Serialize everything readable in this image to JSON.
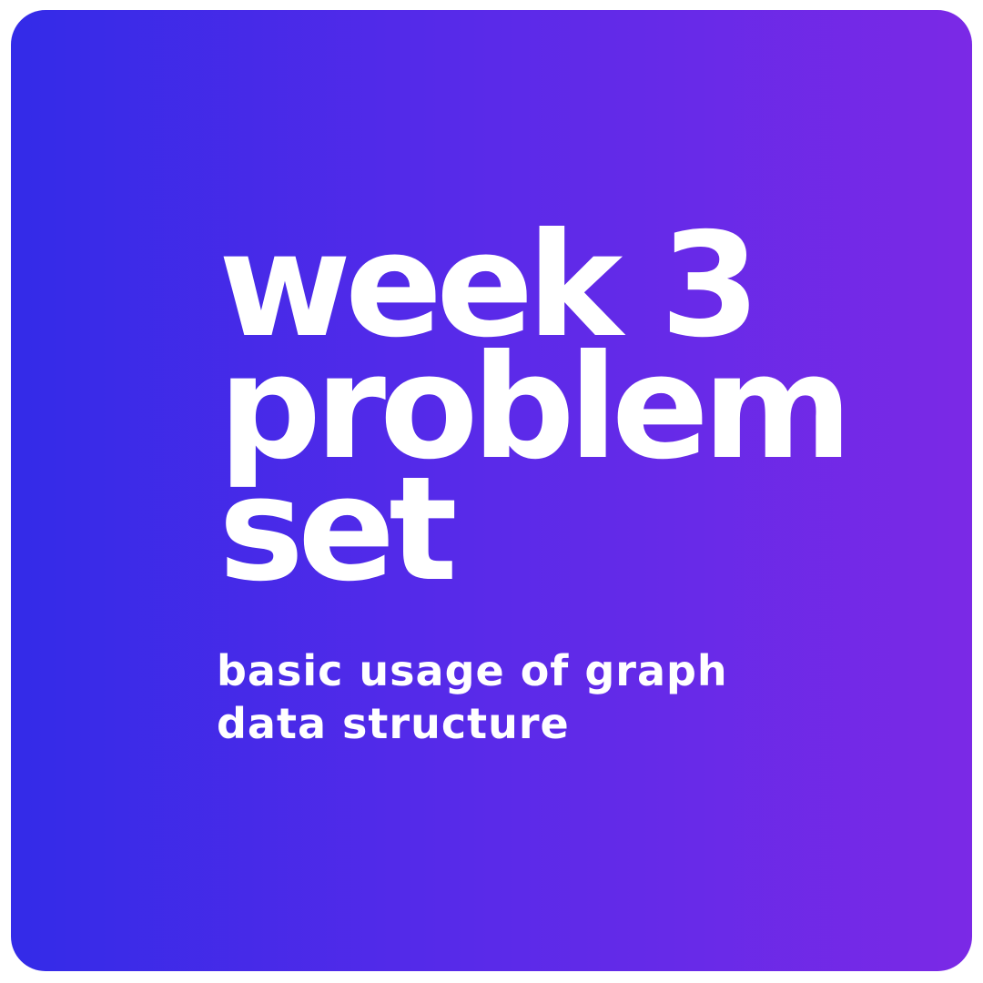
{
  "card": {
    "background_start": "#332be8",
    "background_end": "#7b29e6",
    "text_color": "#ffffff"
  },
  "title": {
    "line1": "week 3",
    "line2": "problem",
    "line3": "set"
  },
  "subtitle": {
    "line1": "basic usage of graph",
    "line2": "data structure"
  }
}
